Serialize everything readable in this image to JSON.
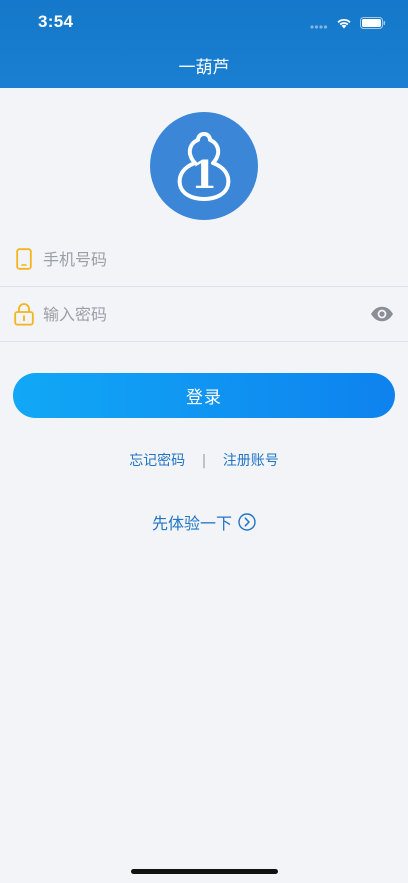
{
  "status_bar": {
    "time": "3:54"
  },
  "header": {
    "title": "一葫芦"
  },
  "logo": {
    "icon": "gourd-logo-icon",
    "numeral": "1"
  },
  "form": {
    "phone": {
      "icon": "phone-icon",
      "placeholder": "手机号码",
      "value": ""
    },
    "password": {
      "icon": "lock-icon",
      "placeholder": "输入密码",
      "value": "",
      "toggle_icon": "eye-icon"
    }
  },
  "login_button": {
    "label": "登录"
  },
  "links": {
    "forgot_password": "忘记密码",
    "separator": "|",
    "register": "注册账号"
  },
  "try_it": {
    "label": "先体验一下",
    "icon": "chevron-right-circle-icon"
  },
  "colors": {
    "header": "#1a7fd2",
    "accent": "#2275c6",
    "button_start": "#11a8f6",
    "button_end": "#0e82ee",
    "field_icon": "#f2b51c",
    "background": "#f2f4f7"
  }
}
